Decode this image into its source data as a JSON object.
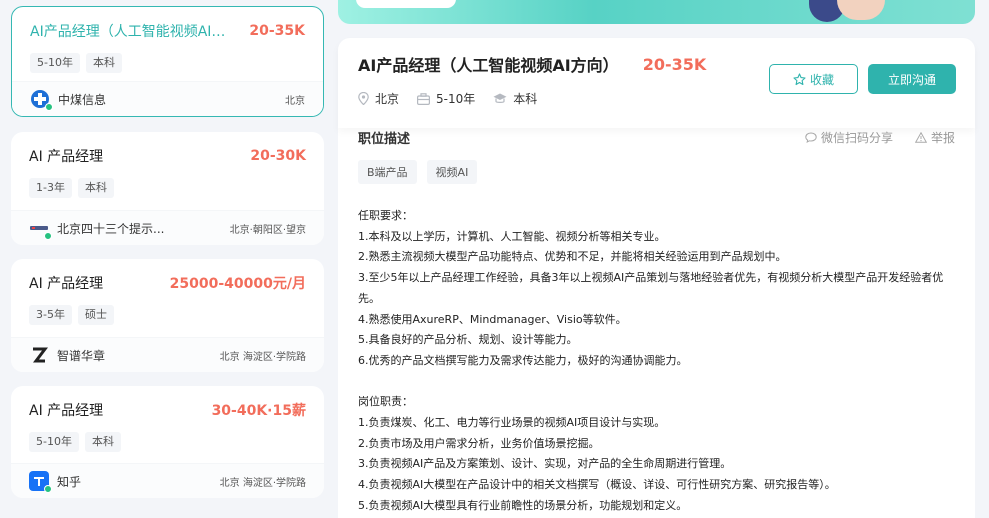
{
  "job_list": [
    {
      "title": "AI产品经理（人工智能视频AI方...",
      "salary": "20-35K",
      "tags": [
        "5-10年",
        "本科"
      ],
      "company": "中煤信息",
      "location": "北京",
      "active": true
    },
    {
      "title": "AI 产品经理",
      "salary": "20-30K",
      "tags": [
        "1-3年",
        "本科"
      ],
      "company": "北京四十三个提示...",
      "location": "北京·朝阳区·望京",
      "active": false
    },
    {
      "title": "AI 产品经理",
      "salary": "25000-40000元/月",
      "tags": [
        "3-5年",
        "硕士"
      ],
      "company": "智谱华章",
      "location": "北京 海淀区·学院路",
      "active": false
    },
    {
      "title": "AI 产品经理",
      "salary": "30-40K·15薪",
      "tags": [
        "5-10年",
        "本科"
      ],
      "company": "知乎",
      "location": "北京 海淀区·学院路",
      "active": false
    }
  ],
  "detail": {
    "title": "AI产品经理（人工智能视频AI方向）",
    "salary": "20-35K",
    "city": "北京",
    "experience": "5-10年",
    "education": "本科",
    "fav_label": "收藏",
    "chat_label": "立即沟通",
    "section_title": "职位描述",
    "share_label": "微信扫码分享",
    "report_label": "举报",
    "skill_tags": [
      "B端产品",
      "视频AI"
    ],
    "requirements_heading": "任职要求：",
    "requirements": [
      "1.本科及以上学历，计算机、人工智能、视频分析等相关专业。",
      "2.熟悉主流视频大模型产品功能特点、优势和不足，并能将相关经验运用到产品规划中。",
      "3.至少5年以上产品经理工作经验，具备3年以上视频AI产品策划与落地经验者优先，有视频分析大模型产品开发经验者优先。",
      "4.熟悉使用AxureRP、Mindmanager、Visio等软件。",
      "5.具备良好的产品分析、规划、设计等能力。",
      "6.优秀的产品文档撰写能力及需求传达能力，极好的沟通协调能力。"
    ],
    "duties_heading": "岗位职责：",
    "duties": [
      "1.负责煤炭、化工、电力等行业场景的视频AI项目设计与实现。",
      "2.负责市场及用户需求分析，业务价值场景挖掘。",
      "3.负责视频AI产品及方案策划、设计、实现，对产品的全生命周期进行管理。",
      "4.负责视频AI大模型在产品设计中的相关文档撰写（概设、详设、可行性研究方案、研究报告等）。",
      "5.负责视频AI大模型具有行业前瞻性的场景分析，功能规划和定义。"
    ]
  },
  "colors": {
    "accent": "#2fb3ad",
    "salary": "#f26d5b"
  }
}
